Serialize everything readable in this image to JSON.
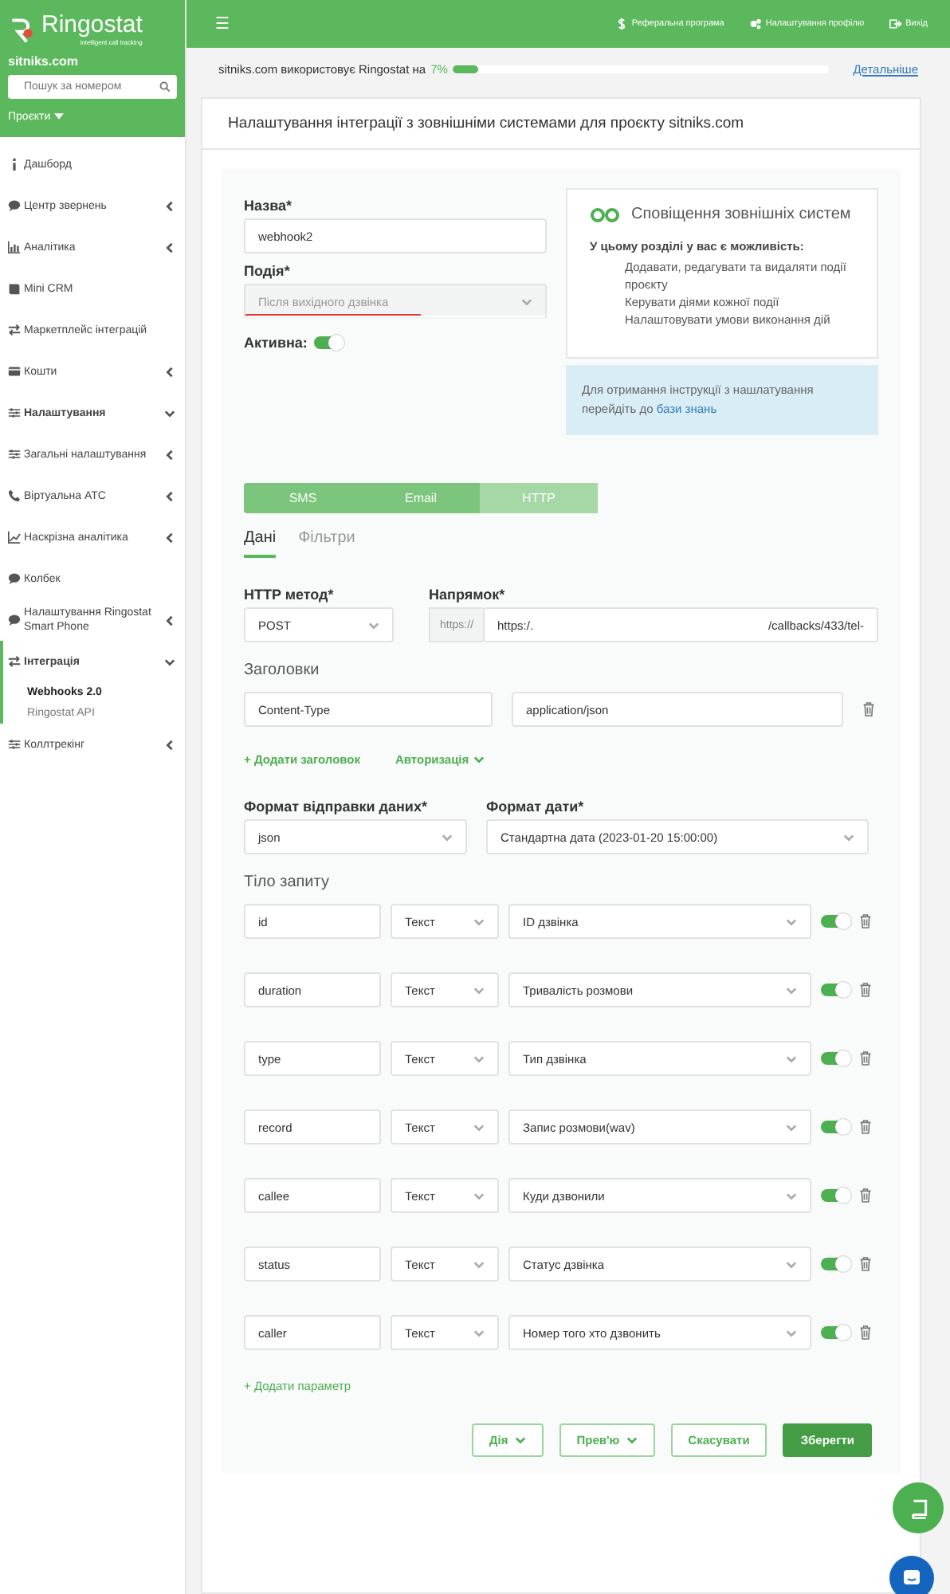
{
  "sidebar": {
    "brand": "Ringostat",
    "tagline": "intelligent call tracking",
    "site": "sitniks.com",
    "search": {
      "placeholder": "Пошук за номером"
    },
    "projects": "Проєкти",
    "items": [
      {
        "kind": "link",
        "label": "Дашборд"
      },
      {
        "kind": "group",
        "label": "Центр звернень",
        "expanded": false,
        "active": false
      },
      {
        "kind": "group",
        "label": "Аналітика",
        "expanded": false,
        "active": false
      },
      {
        "kind": "link",
        "label": "Mini CRM"
      },
      {
        "kind": "link",
        "label": "Маркетплейс інтеграцій"
      },
      {
        "kind": "group",
        "label": "Кошти",
        "expanded": false,
        "active": false
      },
      {
        "kind": "group",
        "label": "Налаштування",
        "expanded": true,
        "active": false
      },
      {
        "kind": "group",
        "label": "Загальні налаштування",
        "expanded": false,
        "active": false
      },
      {
        "kind": "group",
        "label": "Віртуальна АТС",
        "expanded": false,
        "active": false
      },
      {
        "kind": "group",
        "label": "Наскрізна аналітика",
        "expanded": false,
        "active": false
      },
      {
        "kind": "link",
        "label": "Колбек"
      },
      {
        "kind": "group",
        "label": "Налаштування Ringostat Smart Phone",
        "expanded": false,
        "active": false
      },
      {
        "kind": "group",
        "label": "Інтеграція",
        "expanded": true,
        "active": true,
        "children": [
          {
            "label": "Webhooks 2.0",
            "selected": true
          },
          {
            "label": "Ringostat API",
            "selected": false
          }
        ]
      },
      {
        "kind": "group",
        "label": "Коллтрекінг",
        "expanded": false,
        "active": false
      }
    ]
  },
  "topbar": {
    "menu": "☰",
    "links": [
      {
        "label": "Реферальна програма"
      },
      {
        "label": "Налаштування профілю"
      },
      {
        "label": "Вихід"
      }
    ]
  },
  "usage": {
    "text": "sitniks.com використовує Ringostat на",
    "percent": "7%",
    "level": 0.07,
    "link": "Детальніше"
  },
  "card": {
    "title": "Налаштування інтеграції з зовнішніми системами для проєкту sitniks.com"
  },
  "form": {
    "name_label": "Назва*",
    "name_value": "webhook2",
    "event_label": "Подія*",
    "event_value": "Після вихідного дзвінка",
    "active_label": "Активна:",
    "active": true
  },
  "info": {
    "title": "Сповіщення зовнішніх систем",
    "intro": "У цьому розділі у вас є можливість:",
    "points": [
      "Додавати, редагувати та видаляти події проєкту",
      "Керувати діями кожної події",
      "Налаштовувати умови виконання дій"
    ],
    "hint": "Для отримання інструкції з нашлатування перейдіть до",
    "hint_link": "бази знань"
  },
  "channel_tabs": [
    {
      "label": "SMS",
      "selected": false
    },
    {
      "label": "Email",
      "selected": false
    },
    {
      "label": "HTTP",
      "selected": true
    }
  ],
  "data_tabs": [
    {
      "label": "Дані",
      "selected": true
    },
    {
      "label": "Фільтри",
      "selected": false
    }
  ],
  "http": {
    "method_label": "HTTP метод*",
    "method": "POST",
    "url_label": "Напрямок*",
    "prefix": "https://",
    "url_start": "https:/.",
    "url_end": "/callbacks/433/tel-"
  },
  "headers_title": "Заголовки",
  "headers": [
    {
      "name": "Content-Type",
      "value": "application/json"
    }
  ],
  "add_header": "+ Додати заголовок",
  "auth": "Авторизація",
  "format": {
    "send_label": "Формат відправки даних*",
    "send": "json",
    "date_label": "Формат дати*",
    "date": "Стандартна дата (2023-01-20 15:00:00)"
  },
  "body_title": "Тіло запиту",
  "params": [
    {
      "name": "id",
      "type": "Текст",
      "value": "ID дзвінка",
      "on": true
    },
    {
      "name": "duration",
      "type": "Текст",
      "value": "Тривалість розмови",
      "on": true
    },
    {
      "name": "type",
      "type": "Текст",
      "value": "Тип дзвінка",
      "on": true
    },
    {
      "name": "record",
      "type": "Текст",
      "value": "Запис розмови(wav)",
      "on": true
    },
    {
      "name": "callee",
      "type": "Текст",
      "value": "Куди дзвонили",
      "on": true
    },
    {
      "name": "status",
      "type": "Текст",
      "value": "Статус дзвінка",
      "on": true
    },
    {
      "name": "caller",
      "type": "Текст",
      "value": "Номер того хто дзвонить",
      "on": true
    }
  ],
  "add_param": "+ Додати параметр",
  "actions": [
    {
      "label": "Дія",
      "kind": "dropdown"
    },
    {
      "label": "Прев'ю",
      "kind": "dropdown"
    },
    {
      "label": "Скасувати",
      "kind": "outline"
    },
    {
      "label": "Зберегти",
      "kind": "primary"
    }
  ]
}
